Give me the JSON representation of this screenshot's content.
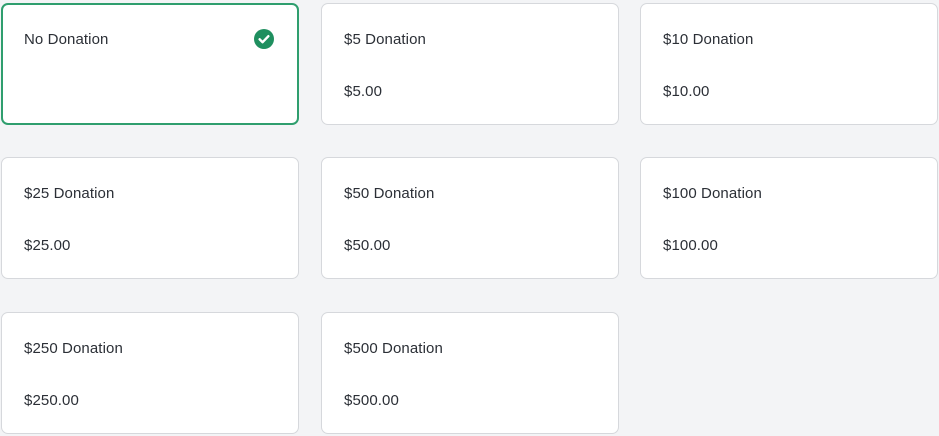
{
  "accent_color": "#2f9e6e",
  "options": [
    {
      "label": "No Donation",
      "amount": "",
      "selected": true,
      "icon": "check-circle-icon"
    },
    {
      "label": "$5 Donation",
      "amount": "$5.00",
      "selected": false
    },
    {
      "label": "$10 Donation",
      "amount": "$10.00",
      "selected": false
    },
    {
      "label": "$25 Donation",
      "amount": "$25.00",
      "selected": false
    },
    {
      "label": "$50 Donation",
      "amount": "$50.00",
      "selected": false
    },
    {
      "label": "$100 Donation",
      "amount": "$100.00",
      "selected": false
    },
    {
      "label": "$250 Donation",
      "amount": "$250.00",
      "selected": false
    },
    {
      "label": "$500 Donation",
      "amount": "$500.00",
      "selected": false
    }
  ]
}
